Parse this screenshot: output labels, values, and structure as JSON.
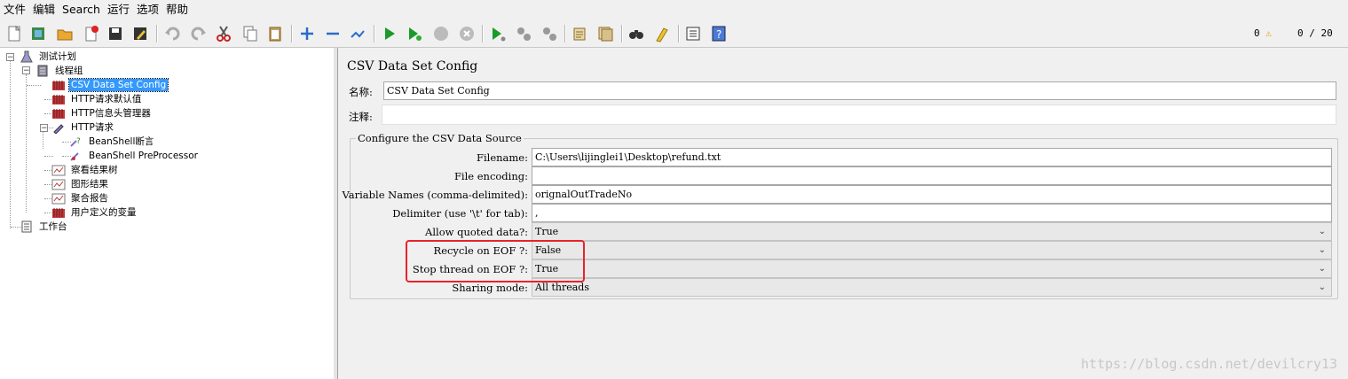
{
  "menu": [
    "文件",
    "编辑",
    "Search",
    "运行",
    "选项",
    "帮助"
  ],
  "toolbar_icons": [
    "new-icon",
    "templates-icon",
    "open-icon",
    "close-icon",
    "save-icon",
    "save-as-icon",
    "undo-icon",
    "redo-icon",
    "cut-icon",
    "copy-icon",
    "paste-icon",
    "expand-icon",
    "collapse-icon",
    "toggle-icon",
    "start-icon",
    "start-no-pause-icon",
    "stop-icon",
    "shutdown-icon",
    "remote-start-icon",
    "remote-stop-icon",
    "remote-shutdown-icon",
    "clear-icon",
    "clear-all-icon",
    "search-icon",
    "reset-search-icon",
    "function-helper-icon",
    "help-icon"
  ],
  "status": {
    "warnings": "0",
    "threads": "0 / 20"
  },
  "tree": {
    "root": "测试计划",
    "thread_group": "线程组",
    "csv": "CSV Data Set Config",
    "http_defaults": "HTTP请求默认值",
    "header_manager": "HTTP信息头管理器",
    "http_request": "HTTP请求",
    "bs_assert": "BeanShell断言",
    "bs_pre": "BeanShell PreProcessor",
    "results_tree": "察看结果树",
    "graph": "图形结果",
    "aggregate": "聚合报告",
    "user_vars": "用户定义的变量",
    "workbench": "工作台"
  },
  "panel": {
    "title": "CSV Data Set Config",
    "name_label": "名称:",
    "name_value": "CSV Data Set Config",
    "comment_label": "注释:",
    "comment_value": "",
    "group_title": "Configure the CSV Data Source",
    "filename_label": "Filename:",
    "filename_value": "C:\\Users\\lijinglei1\\Desktop\\refund.txt",
    "encoding_label": "File encoding:",
    "encoding_value": "",
    "varnames_label": "Variable Names (comma-delimited):",
    "varnames_value": "orignalOutTradeNo",
    "delimiter_label": "Delimiter (use '\\t' for tab):",
    "delimiter_value": ",",
    "quoted_label": "Allow quoted data?:",
    "quoted_value": "True",
    "recycle_label": "Recycle on EOF ?:",
    "recycle_value": "False",
    "stop_label": "Stop thread on EOF ?:",
    "stop_value": "True",
    "sharing_label": "Sharing mode:",
    "sharing_value": "All threads"
  },
  "watermark": "https://blog.csdn.net/devilcry13"
}
